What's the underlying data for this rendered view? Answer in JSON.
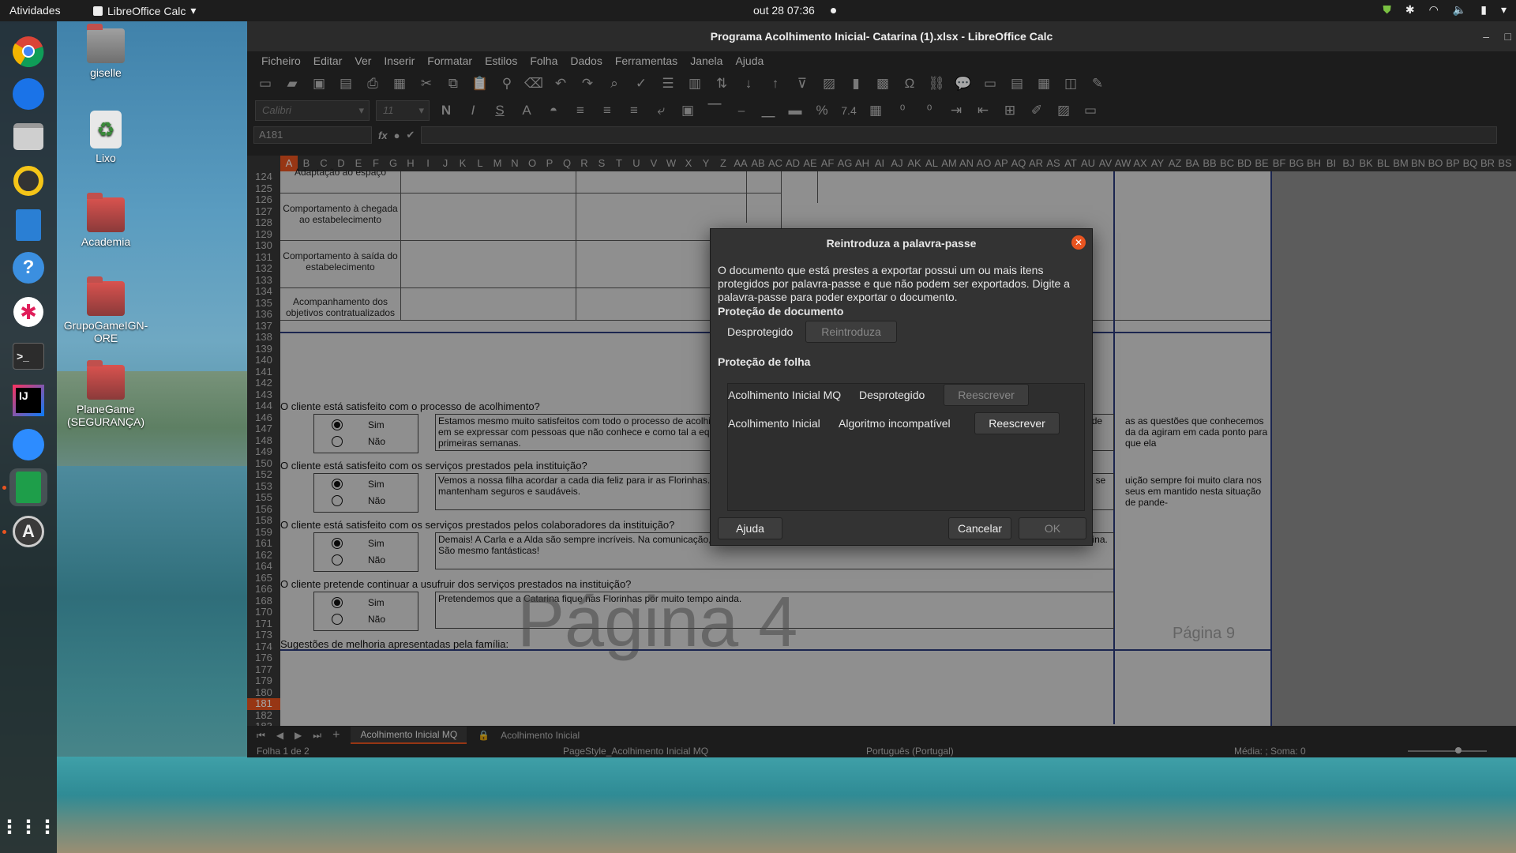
{
  "topbar": {
    "activities": "Atividades",
    "app_menu": "LibreOffice Calc",
    "clock": "out 28  07:36"
  },
  "desktop": {
    "icons": [
      {
        "label": "giselle",
        "icon": "home-folder-icon"
      },
      {
        "label": "Lixo",
        "icon": "trash-icon"
      },
      {
        "label": "Academia",
        "icon": "folder-icon"
      },
      {
        "label": "GrupoGameIGN-ORE",
        "icon": "folder-icon"
      },
      {
        "label": "PlaneGame (SEGURANÇA)",
        "icon": "folder-icon"
      }
    ]
  },
  "dock": {
    "items": [
      "chrome-icon",
      "thunderbird-icon",
      "files-icon",
      "rhythmbox-icon",
      "writer-icon",
      "help-icon",
      "slack-icon",
      "terminal-icon",
      "intellij-icon",
      "zoom-icon",
      "calc-icon",
      "software-updater-icon",
      "app-grid-icon"
    ]
  },
  "window": {
    "title": "Programa Acolhimento Inicial- Catarina (1).xlsx - LibreOffice Calc",
    "menu": [
      "Ficheiro",
      "Editar",
      "Ver",
      "Inserir",
      "Formatar",
      "Estilos",
      "Folha",
      "Dados",
      "Ferramentas",
      "Janela",
      "Ajuda"
    ],
    "font_name": "Calibri",
    "font_size": "11",
    "bold": "N",
    "italic": "I",
    "underline": "S",
    "percent": "%",
    "number_format": "7.4",
    "name_box": "A181",
    "fx": "fx"
  },
  "grid": {
    "columns": [
      "A",
      "B",
      "C",
      "D",
      "E",
      "F",
      "G",
      "H",
      "I",
      "J",
      "K",
      "L",
      "M",
      "N",
      "O",
      "P",
      "Q",
      "R",
      "S",
      "T",
      "U",
      "V",
      "W",
      "X",
      "Y",
      "Z",
      "AA",
      "AB",
      "AC",
      "AD",
      "AE",
      "AF",
      "AG",
      "AH",
      "AI",
      "AJ",
      "AK",
      "AL",
      "AM",
      "AN",
      "AO",
      "AP",
      "AQ",
      "AR",
      "AS",
      "AT",
      "AU",
      "AV",
      "AW",
      "AX",
      "AY",
      "AZ",
      "BA",
      "BB",
      "BC",
      "BD",
      "BE",
      "BF",
      "BG",
      "BH",
      "BI",
      "BJ",
      "BK",
      "BL",
      "BM",
      "BN",
      "BO",
      "BP",
      "BQ",
      "BR",
      "BS"
    ],
    "selected_column": "A",
    "rows": [
      "124",
      "125",
      "126",
      "127",
      "128",
      "129",
      "130",
      "131",
      "132",
      "133",
      "134",
      "135",
      "136",
      "137",
      "138",
      "139",
      "140",
      "141",
      "142",
      "143",
      "144",
      "146",
      "147",
      "148",
      "149",
      "150",
      "152",
      "153",
      "155",
      "156",
      "158",
      "159",
      "161",
      "162",
      "164",
      "165",
      "166",
      "168",
      "170",
      "171",
      "173",
      "174",
      "176",
      "177",
      "179",
      "180",
      "181",
      "182",
      "183"
    ],
    "selected_row": "181"
  },
  "sheet": {
    "labels": [
      "Adaptação ao espaço",
      "Comportamento à chegada ao estabelecimento",
      "Comportamento à saída do estabelecimento",
      "Acompanhamento dos objetivos contratualizados"
    ],
    "questions": [
      {
        "q": "O cliente está satisfeito com o processo de acolhimento?",
        "yes": "Sim",
        "no": "Não",
        "answer": "Estamos mesmo muito satisfeitos com todo o processo de acolhimento. Foram tidas em conta todas as questões que conhecemos da sua timidez, dificuldade em se expressar com pessoas que não conhece e como tal a equipa agiram em cada ponto para que ela se sentisse acolhida e se desenvolvesse nestas primeiras semanas.",
        "answer_right": "as as questões que conhecemos da da agiram em cada ponto para que ela"
      },
      {
        "q": "O cliente está satisfeito com os serviços prestados pela instituição?",
        "yes": "Sim",
        "no": "Não",
        "answer": "Vemos a nossa filha acordar a cada dia feliz para ir as Florinhas. Comunicados e prestativa a atender qualquer solicitação no momento, mia para que todos se mantenham seguros e saudáveis.",
        "answer_right": "uição sempre foi muito clara nos seus em mantido nesta situação de pande-"
      },
      {
        "q": "O cliente está satisfeito com os serviços prestados pelos colaboradores da instituição?",
        "yes": "Sim",
        "no": "Não",
        "answer": "Demais! A Carla e a Alda são sempre incríveis. Na comunicação, na partilha do trabalho que está sendo realizado na sala de aula e no carinho com a Catarina. São mesmo fantásticas!",
        "answer_right": ""
      },
      {
        "q": "O cliente pretende continuar a usufruir dos serviços prestados na instituição?",
        "yes": "Sim",
        "no": "Não",
        "answer": "Pretendemos que a Catarina fique nas Florinhas por muito tempo ainda.",
        "answer_right": ""
      }
    ],
    "suggestions_label": "Sugestões de melhoria apresentadas pela família:",
    "watermark_main": "Página 4",
    "watermark_right": "Página 9"
  },
  "tabs": {
    "sheets": [
      "Acolhimento Inicial MQ",
      "Acolhimento Inicial"
    ],
    "active": "Acolhimento Inicial MQ"
  },
  "status": {
    "sheet": "Folha 1 de 2",
    "page_style": "PageStyle_Acolhimento Inicial MQ",
    "language": "Português (Portugal)",
    "sum": "Média: ; Soma: 0"
  },
  "dialog": {
    "title": "Reintroduza a palavra-passe",
    "message": "O documento que está prestes a exportar possui um ou mais itens protegidos por palavra-passe e que não podem ser exportados. Digite a palavra-passe para poder exportar o documento.",
    "doc_section": "Proteção de documento",
    "doc_status": "Desprotegido",
    "doc_button": "Reintroduza",
    "sheet_section": "Proteção de folha",
    "sheets": [
      {
        "name": "Acolhimento Inicial MQ",
        "status": "Desprotegido",
        "button": "Reescrever",
        "enabled": false
      },
      {
        "name": "Acolhimento Inicial",
        "status": "Algoritmo incompatível",
        "button": "Reescrever",
        "enabled": true
      }
    ],
    "help": "Ajuda",
    "cancel": "Cancelar",
    "ok": "OK"
  }
}
